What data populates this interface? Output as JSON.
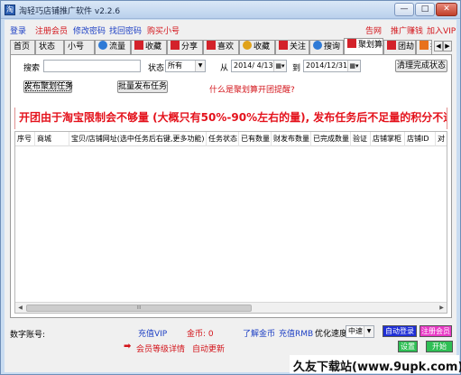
{
  "window": {
    "title": "淘轻巧店铺推广软件 v2.2.6",
    "minimize": "—",
    "maximize": "□",
    "close": "✕"
  },
  "menu": {
    "login": "登录",
    "register": "注册会员",
    "change_password": "修改密码",
    "recover_password": "找回密码",
    "buy_account": "购买小号",
    "announcement": "告网",
    "promo_earn": "推广赚钱",
    "join_vip": "加入VIP"
  },
  "tabs": [
    {
      "label": "首页",
      "icon": null
    },
    {
      "label": "状态",
      "icon": null
    },
    {
      "label": "小号",
      "icon": null
    },
    {
      "label": "流量",
      "icon": "globe-icon"
    },
    {
      "label": "收藏",
      "icon": "favorite-icon"
    },
    {
      "label": "分享",
      "icon": "share-icon"
    },
    {
      "label": "喜欢",
      "icon": "like-icon"
    },
    {
      "label": "收藏",
      "icon": "favorite2-icon"
    },
    {
      "label": "关注",
      "icon": "follow-icon"
    },
    {
      "label": "搜询",
      "icon": "search-query-icon"
    },
    {
      "label": "聚划算",
      "icon": "juhuasuan-icon"
    },
    {
      "label": "团劫",
      "icon": "group-icon"
    },
    {
      "label": "拍",
      "icon": "auction-icon"
    }
  ],
  "filters": {
    "search_label": "搜索",
    "search_value": "",
    "status_label": "状态",
    "status_value": "所有",
    "from_label": "从",
    "from_date": "2014/ 4/13",
    "to_label": "到",
    "to_date": "2014/12/31",
    "clear_completed_button": "清理完成状态"
  },
  "actions": {
    "publish_juhuasuan": "发布聚划任务",
    "batch_publish": "批量发布任务",
    "help_link": "什么是聚划算开团提醒?"
  },
  "notice": "开团由于淘宝限制会不够量 (大概只有50%-90%左右的量), 发布任务后不足量的积分不退不",
  "table": {
    "columns": [
      "序号",
      "商城",
      "宝贝/店铺网址(选中任务后右键,更多功能)",
      "任务状态",
      "已有数量",
      "财发布数量",
      "已完成数量",
      "验证",
      "店铺掌柜",
      "店铺ID",
      "对"
    ],
    "rows": [],
    "scroll_thumb": "III"
  },
  "footer": {
    "current_account_label": "数字账号:",
    "current_account_value": "",
    "recharge_vip": "充值VIP",
    "gold_label": "金币: 0",
    "learn_gold": "了解金币",
    "recharge_rmb": "充值RMB",
    "speed_label": "优化速度",
    "speed_value": "中速",
    "auto_login": "自动登录",
    "register_member": "注册会员",
    "member_level_detail": "会员等级详情",
    "auto_update": "自动更新",
    "settings": "设置",
    "start": "开始"
  },
  "watermark": "久友下载站(www.9upk.com)",
  "colors": {
    "link_blue": "#1d3fc4",
    "link_red": "#d3151b",
    "notice_red": "#e4121c",
    "window_frame": "#c9dcf1",
    "auto_login_btn": "#1f2fd6",
    "register_btn": "#e83ac6",
    "settings_btn": "#2fbf55"
  }
}
